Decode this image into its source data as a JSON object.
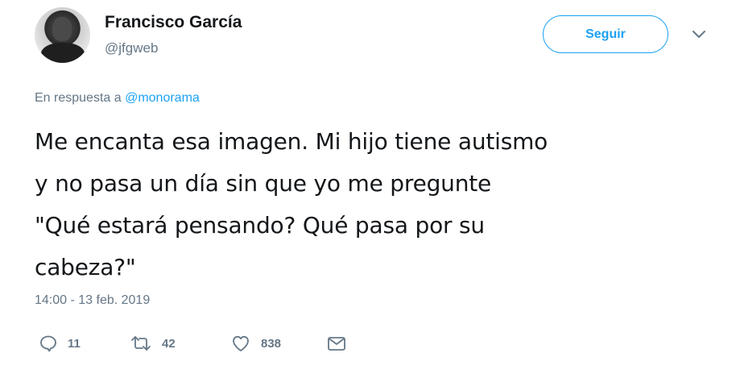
{
  "user": {
    "display_name": "Francisco García",
    "handle": "@jfgweb"
  },
  "header": {
    "follow_label": "Seguir"
  },
  "reply_context": {
    "prefix": "En respuesta a",
    "mention": "@monorama"
  },
  "tweet": {
    "text_lines": [
      "Me encanta esa imagen. Mi hijo tiene autismo",
      "y no pasa un día sin que yo me pregunte",
      "\"Qué estará pensando? Qué pasa por su",
      "cabeza?\""
    ],
    "timestamp": "14:00 - 13 feb. 2019"
  },
  "actions": {
    "reply_count": "11",
    "retweet_count": "42",
    "like_count": "838"
  },
  "colors": {
    "accent": "#1da1f2",
    "secondary_text": "#657786",
    "primary_text": "#14171a"
  },
  "icons": {
    "reply": "reply-icon",
    "retweet": "retweet-icon",
    "like": "heart-icon",
    "dm": "envelope-icon",
    "caret": "chevron-down-icon"
  }
}
